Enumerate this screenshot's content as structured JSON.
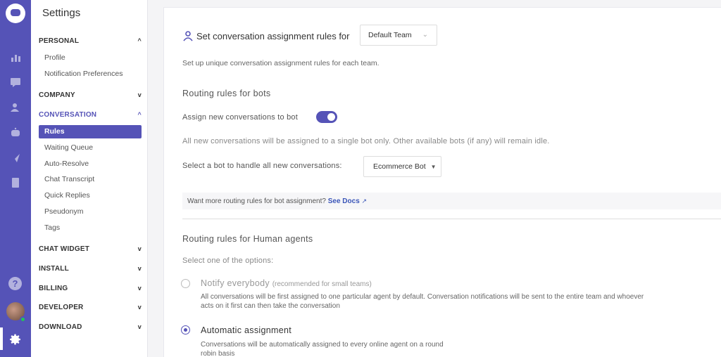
{
  "rail": {
    "icons": [
      "reports-icon",
      "conversations-icon",
      "users-icon",
      "bot-icon",
      "campaign-icon",
      "docs-icon",
      "help-icon",
      "avatar",
      "settings-icon"
    ]
  },
  "sidebar": {
    "title": "Settings",
    "sections": [
      {
        "label": "PERSONAL",
        "chevron": "^",
        "items": [
          "Profile",
          "Notification Preferences"
        ]
      },
      {
        "label": "COMPANY",
        "chevron": "v"
      },
      {
        "label": "CONVERSATION",
        "chevron": "^",
        "items": [
          "Rules",
          "Waiting Queue",
          "Auto-Resolve",
          "Chat Transcript",
          "Quick Replies",
          "Pseudonym",
          "Tags"
        ]
      },
      {
        "label": "CHAT WIDGET",
        "chevron": "v"
      },
      {
        "label": "INSTALL",
        "chevron": "v"
      },
      {
        "label": "BILLING",
        "chevron": "v"
      },
      {
        "label": "DEVELOPER",
        "chevron": "v"
      },
      {
        "label": "DOWNLOAD",
        "chevron": "v"
      }
    ],
    "active_item": "Rules"
  },
  "main": {
    "header": "Set conversation assignment rules for",
    "team_select": "Default Team",
    "subtitle": "Set up unique conversation assignment rules for each team.",
    "bots_heading": "Routing rules for bots",
    "assign_label": "Assign new conversations to bot",
    "assign_toggle": true,
    "bots_info": "All new conversations will be assigned to a single bot only. Other available bots (if any) will remain idle.",
    "select_bot_label": "Select a bot to handle all new conversations:",
    "bot_select": "Ecommerce Bot",
    "docs_text": "Want more routing rules for bot assignment?",
    "docs_link": "See Docs",
    "human_heading": "Routing rules for Human agents",
    "select_option": "Select one of the options:",
    "options": [
      {
        "title": "Notify everybody",
        "note": "(recommended for small teams)",
        "desc1": "All conversations will be first assigned to one particular agent by default. Conversation notifications will be sent to the entire team and whoever",
        "desc2": "acts on it first can then take the conversation",
        "selected": false
      },
      {
        "title": "Automatic assignment",
        "desc1": "Conversations will be automatically assigned to every online agent on a round",
        "desc2": "robin basis",
        "selected": true
      }
    ]
  },
  "colors": {
    "accent": "#5553b7",
    "link": "#3a55b8"
  }
}
